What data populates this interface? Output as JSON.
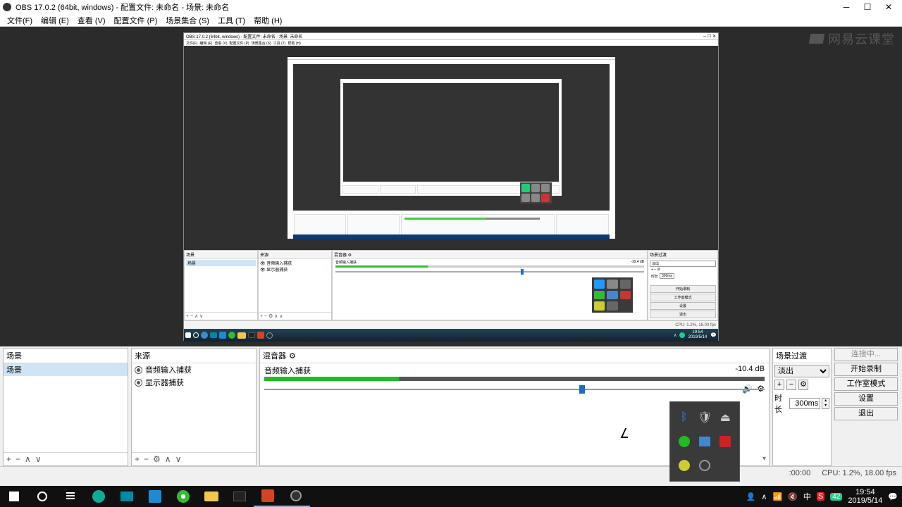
{
  "title": "OBS 17.0.2 (64bit, windows) - 配置文件: 未命名 - 场景: 未命名",
  "menu": {
    "file": "文件(F)",
    "edit": "编辑 (E)",
    "view": "查看 (V)",
    "profile": "配置文件 (P)",
    "scene_collection": "场景集合 (S)",
    "tools": "工具 (T)",
    "help": "帮助 (H)"
  },
  "watermark": "网易云课堂",
  "docks": {
    "scenes": {
      "title": "场景",
      "items": [
        "场景"
      ]
    },
    "sources": {
      "title": "来源",
      "items": [
        {
          "label": "音频输入捕获",
          "visible": true
        },
        {
          "label": "显示器捕获",
          "visible": true
        }
      ]
    },
    "mixer": {
      "title": "混音器",
      "channel_label": "音频输入捕获",
      "level_db": "-10.4 dB"
    },
    "transitions": {
      "title": "场景过渡",
      "selected": "淡出",
      "duration_label": "时长",
      "duration_value": "300ms"
    },
    "controls": {
      "connecting": "连接中...",
      "start_record": "开始录制",
      "studio_mode": "工作室模式",
      "settings": "设置",
      "exit": "退出"
    }
  },
  "status": {
    "time": ":00:00",
    "cpu": "CPU: 1.2%, 18.00 fps"
  },
  "taskbar": {
    "time": "19:54",
    "date": "2019/5/14",
    "badge": "42"
  },
  "inner": {
    "title": "OBS 17.0.2 (64bit, windows) - 配置文件: 未命名 - 场景: 未命名",
    "menu": [
      "文件(F)",
      "编辑 (E)",
      "查看 (V)",
      "配置文件 (P)",
      "场景集合 (S)",
      "工具 (T)",
      "帮助 (H)"
    ],
    "scenes_title": "场景",
    "scene_item": "场景",
    "sources_title": "来源",
    "src1": "音频输入捕获",
    "src2": "显示器捕获",
    "mixer_title": "混音器 ⚙",
    "mix_label": "音频输入捕获",
    "mix_db": "-10.4 dB",
    "trans_title": "场景过渡",
    "trans_sel": "淡出",
    "dur_lbl": "时长",
    "dur_val": "300ms",
    "btn1": "开始录制",
    "btn2": "工作室模式",
    "btn3": "设置",
    "btn4": "退出",
    "status": "CPU: 1.2%, 18.00 fps",
    "tb_time": "19:54",
    "tb_date": "2019/5/14"
  }
}
